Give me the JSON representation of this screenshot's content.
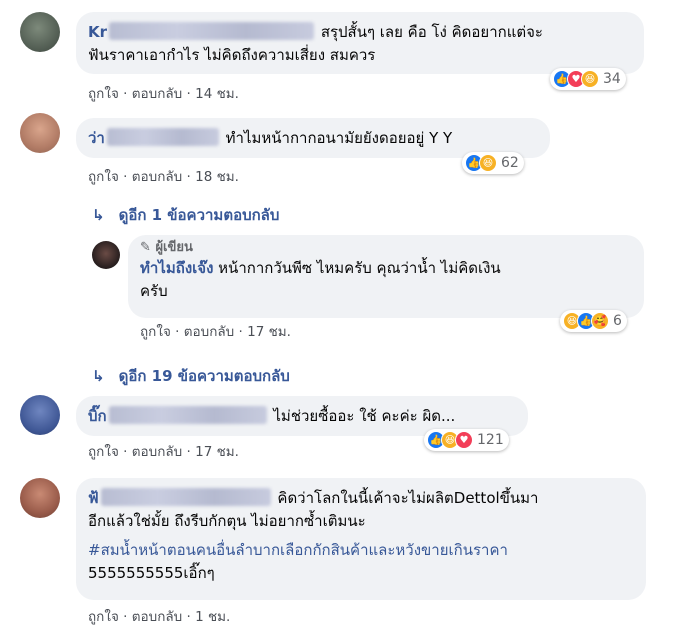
{
  "actions": {
    "like": "ถูกใจ",
    "reply": "ตอบกลับ",
    "sep": "·"
  },
  "comments": [
    {
      "name": "Kr",
      "text_line1": "สรุปสั้นๆ เลย คือ โง่ คิดอยากแต่จะ",
      "text_line2": "ฟันราคาเอากำไร ไม่คิดถึงความเสี่ยง สมควร",
      "time": "14 ชม.",
      "reaction_count": "34",
      "reaction_icons": [
        "like-icon",
        "love-icon",
        "haha-icon"
      ]
    },
    {
      "name": "ว่า",
      "text_line1": "ทำไมหน้ากากอนามัยยังดอยอยู่ Y  Y",
      "time": "18 ชม.",
      "reaction_count": "62",
      "reaction_icons": [
        "like-icon",
        "haha-icon"
      ]
    },
    {
      "name": "บิ๊ก",
      "text_line1": "ไม่ช่วยซื้ออะ ใช้ คะค่ะ ผิด...",
      "time": "17 ชม.",
      "reaction_count": "121",
      "reaction_icons": [
        "like-icon",
        "haha-icon",
        "love-icon"
      ]
    },
    {
      "name": "ฟ้",
      "text_line1": "คิดว่าโลกในนี้เค้าจะไม่ผลิตDettolขึ้นมา",
      "text_line2": "อีกแล้วใช่มั้ย ถึงรีบกักตุน ไม่อยากซ้ำเติมนะ",
      "hashtag": "#สมน้ำหน้าตอนคนอื่นลำบากเลือกกักสินค้าและหวังขายเกินราคา",
      "text_line3": "5555555555เอิ๊กๆ",
      "time": "1 ชม."
    }
  ],
  "reply_thread_1": {
    "view_more": "ดูอีก 1 ข้อความตอบกลับ",
    "author_badge": "ผู้เขียน",
    "name": "ทำไมถึงเจ๊ง",
    "text_line1": "หน้ากากวันพีซ ไหมครับ คุณว่าน้ำ ไม่คิดเงิน",
    "text_line2": "ครับ",
    "time": "17 ชม.",
    "reaction_count": "6",
    "reaction_icons": [
      "haha-icon",
      "like-icon",
      "care-icon"
    ]
  },
  "view_more_2": "ดูอีก 19 ข้อความตอบกลับ",
  "colors": {
    "link": "#385898",
    "bubble": "#f0f2f5",
    "like": "#1877f2",
    "love": "#f33e58",
    "haha": "#f7b125"
  }
}
